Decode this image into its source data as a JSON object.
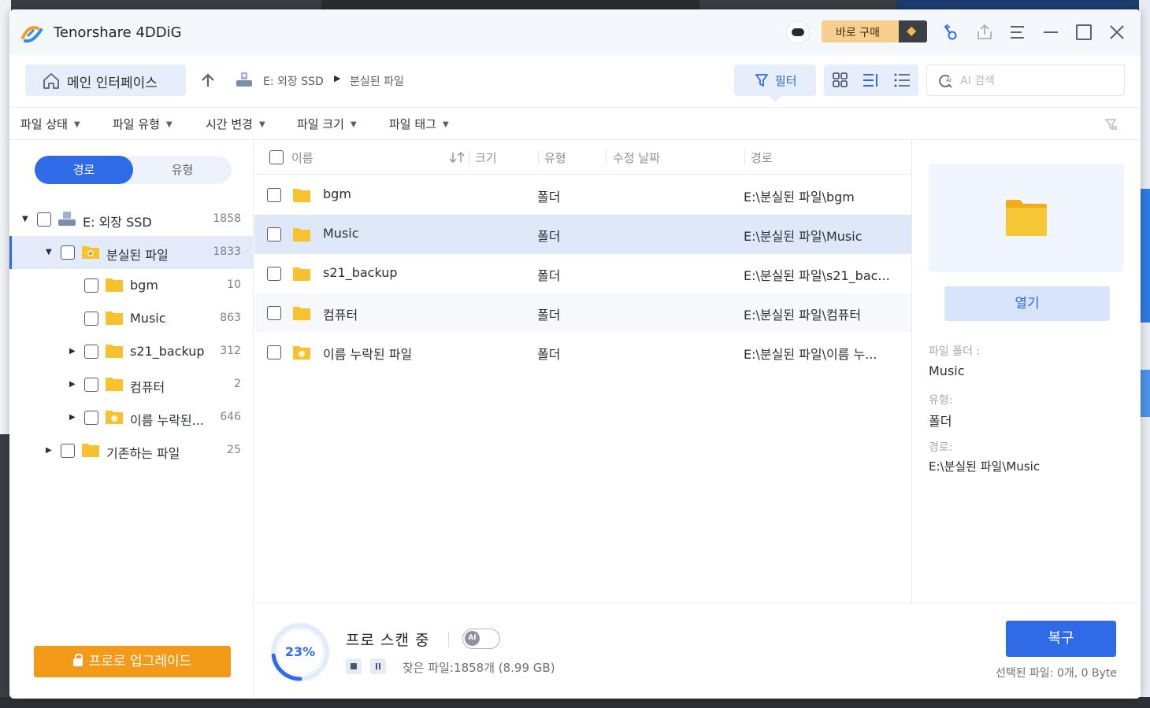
{
  "app": {
    "title": "Tenorshare 4DDiG",
    "buy_label": "바로 구매"
  },
  "nav": {
    "home_label": "메인 인터페이스",
    "breadcrumb_drive": "E: 외장 SSD",
    "breadcrumb_folder": "분실된 파일",
    "filter_label": "필터",
    "search_placeholder": "AI 검색"
  },
  "filters": [
    {
      "label": "파일 상태"
    },
    {
      "label": "파일 유형"
    },
    {
      "label": "시간 변경"
    },
    {
      "label": "파일 크기"
    },
    {
      "label": "파일 태그"
    }
  ],
  "sidebar": {
    "tab_path": "경로",
    "tab_type": "유형",
    "tree": [
      {
        "label": "E: 외장 SSD",
        "count": "1858"
      },
      {
        "label": "분실된 파일",
        "count": "1833"
      },
      {
        "label": "bgm",
        "count": "10"
      },
      {
        "label": "Music",
        "count": "863"
      },
      {
        "label": "s21_backup",
        "count": "312"
      },
      {
        "label": "컴퓨터",
        "count": "2"
      },
      {
        "label": "이름 누락된...",
        "count": "646"
      },
      {
        "label": "기존하는 파일",
        "count": "25"
      }
    ],
    "upgrade_label": "프로로 업그레이드"
  },
  "table": {
    "headers": {
      "name": "이름",
      "size": "크기",
      "type": "유형",
      "modified": "수정 날짜",
      "path": "경로"
    },
    "rows": [
      {
        "name": "bgm",
        "type": "폴더",
        "path": "E:\\분실된 파일\\bgm"
      },
      {
        "name": "Music",
        "type": "폴더",
        "path": "E:\\분실된 파일\\Music"
      },
      {
        "name": "s21_backup",
        "type": "폴더",
        "path": "E:\\분실된 파일\\s21_bac..."
      },
      {
        "name": "컴퓨터",
        "type": "폴더",
        "path": "E:\\분실된 파일\\컴퓨터"
      },
      {
        "name": "이름 누락된 파일",
        "type": "폴더",
        "path": "E:\\분실된 파일\\이름 누..."
      }
    ]
  },
  "preview": {
    "open_label": "열기",
    "folder_label": "파일 폴더 :",
    "folder_value": "Music",
    "type_label": "유형:",
    "type_value": "폴더",
    "path_label": "경로:",
    "path_value": "E:\\분실된 파일\\Music"
  },
  "status": {
    "progress_text": "23%",
    "progress": 0.23,
    "scan_title": "프로 스캔 중",
    "ai_toggle_label": "AI",
    "found_text": "찾은 파일:1858개 (8.99 GB)",
    "recover_label": "복구",
    "selected_text": "선택된 파일: 0개, 0 Byte"
  },
  "colors": {
    "accent": "#2f6be6",
    "upgrade": "#f39a18",
    "folder": "#f7c12f",
    "selected_row": "#dfe8f8"
  }
}
